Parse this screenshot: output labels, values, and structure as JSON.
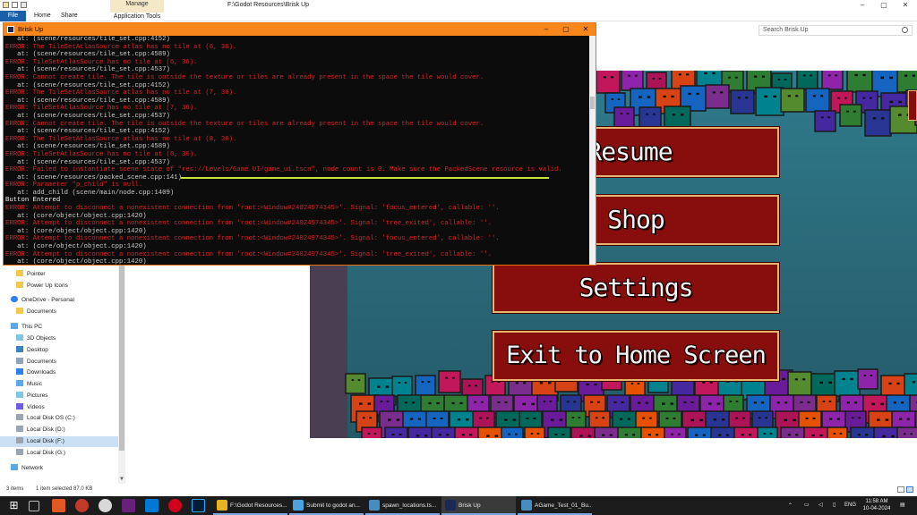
{
  "explorer": {
    "title_path": "F:\\Godot Resources\\Brisk Up",
    "tabs": {
      "file": "File",
      "home": "Home",
      "share": "Share",
      "manage_context": "Manage",
      "application_tools": "Application Tools"
    },
    "search_placeholder": "Search Brisk Up",
    "nav_items": [
      {
        "label": "Pointer",
        "icon": "folder-icon"
      },
      {
        "label": "Power Up Icons",
        "icon": "folder-icon"
      },
      {
        "label": "OneDrive - Personal",
        "icon": "onedrive-icon"
      },
      {
        "label": "Documents",
        "icon": "folder-icon"
      },
      {
        "label": "This PC",
        "icon": "pc-icon"
      },
      {
        "label": "3D Objects",
        "icon": "folder-icon"
      },
      {
        "label": "Desktop",
        "icon": "folder-icon"
      },
      {
        "label": "Documents",
        "icon": "folder-icon"
      },
      {
        "label": "Downloads",
        "icon": "download-icon"
      },
      {
        "label": "Music",
        "icon": "music-icon"
      },
      {
        "label": "Pictures",
        "icon": "pictures-icon"
      },
      {
        "label": "Videos",
        "icon": "videos-icon"
      },
      {
        "label": "Local Disk OS (C:)",
        "icon": "drive-icon"
      },
      {
        "label": "Local Disk (D:)",
        "icon": "drive-icon"
      },
      {
        "label": "Local Disk (F:)",
        "icon": "drive-icon",
        "selected": true
      },
      {
        "label": "Local Disk (G:)",
        "icon": "drive-icon"
      },
      {
        "label": "Network",
        "icon": "network-icon"
      }
    ],
    "status": {
      "items": "3 items",
      "selected": "1 item selected  87.0 KB"
    }
  },
  "console": {
    "title": "Brisk Up",
    "lines": [
      {
        "t": "at",
        "text": "   at: (scene/resources/tile_set.cpp:4152)"
      },
      {
        "t": "error",
        "text": "ERROR: The TileSetAtlasSource atlas has no tile at (6, 36)."
      },
      {
        "t": "at",
        "text": "   at: (scene/resources/tile_set.cpp:4589)"
      },
      {
        "t": "error",
        "text": "ERROR: TileSetAtlasSource has no tile at (6, 36)."
      },
      {
        "t": "at",
        "text": "   at: (scene/resources/tile_set.cpp:4537)"
      },
      {
        "t": "error",
        "text": "ERROR: Cannot create tile. The tile is outside the texture or tiles are already present in the space the tile would cover."
      },
      {
        "t": "at",
        "text": "   at: (scene/resources/tile_set.cpp:4152)"
      },
      {
        "t": "error",
        "text": "ERROR: The TileSetAtlasSource atlas has no tile at (7, 36)."
      },
      {
        "t": "at",
        "text": "   at: (scene/resources/tile_set.cpp:4589)"
      },
      {
        "t": "error",
        "text": "ERROR: TileSetAtlasSource has no tile at (7, 36)."
      },
      {
        "t": "at",
        "text": "   at: (scene/resources/tile_set.cpp:4537)"
      },
      {
        "t": "error",
        "text": "ERROR: Cannot create tile. The tile is outside the texture or tiles are already present in the space the tile would cover."
      },
      {
        "t": "at",
        "text": "   at: (scene/resources/tile_set.cpp:4152)"
      },
      {
        "t": "error",
        "text": "ERROR: The TileSetAtlasSource atlas has no tile at (8, 36)."
      },
      {
        "t": "at",
        "text": "   at: (scene/resources/tile_set.cpp:4589)"
      },
      {
        "t": "error",
        "text": "ERROR: TileSetAtlasSource has no tile at (8, 36)."
      },
      {
        "t": "at",
        "text": "   at: (scene/resources/tile_set.cpp:4537)"
      },
      {
        "t": "error",
        "text": "ERROR: Failed to instantiate scene state of \"res://Levels/Game UI/game_ui.tscn\", node count is 0. Make sure the PackedScene resource is valid."
      },
      {
        "t": "at",
        "text": "   at: (scene/resources/packed_scene.cpp:141)"
      },
      {
        "t": "error",
        "text": "ERROR: Parameter \"p_child\" is null."
      },
      {
        "t": "at",
        "text": "   at: add_child (scene/main/node.cpp:1409)"
      },
      {
        "t": "info",
        "text": "Button Entered"
      },
      {
        "t": "error",
        "text": "ERROR: Attempt to disconnect a nonexistent connection from 'root:<Window#24024974345>'. Signal: 'focus_entered', callable: ''."
      },
      {
        "t": "at",
        "text": "   at: (core/object/object.cpp:1420)"
      },
      {
        "t": "error",
        "text": "ERROR: Attempt to disconnect a nonexistent connection from 'root:<Window#24024974345>'. Signal: 'tree_exited', callable: ''."
      },
      {
        "t": "at",
        "text": "   at: (core/object/object.cpp:1420)"
      },
      {
        "t": "error",
        "text": "ERROR: Attempt to disconnect a nonexistent connection from 'root:<Window#24024974345>'. Signal: 'focus_entered', callable: ''."
      },
      {
        "t": "at",
        "text": "   at: (core/object/object.cpp:1420)"
      },
      {
        "t": "error",
        "text": "ERROR: Attempt to disconnect a nonexistent connection from 'root:<Window#24024974345>'. Signal: 'tree_exited', callable: ''."
      },
      {
        "t": "at",
        "text": "   at: (core/object/object.cpp:1420)"
      }
    ]
  },
  "game_menu": {
    "resume": "Resume",
    "shop": "Shop",
    "settings": "Settings",
    "exit": "Exit to Home Screen"
  },
  "taskbar": {
    "tasks": [
      {
        "label": "F:\\Godot Resources...",
        "icon_color": "#e6b422"
      },
      {
        "label": "Submit to godot an...",
        "icon_color": "#4aa3df"
      },
      {
        "label": "spawn_locations.ts...",
        "icon_color": "#478cbf"
      },
      {
        "label": "Brisk Up",
        "icon_color": "#1b2a55",
        "active": true
      },
      {
        "label": "AGame_Test_01_Bu...",
        "icon_color": "#478cbf"
      }
    ],
    "language": "ENG",
    "time": "11:58 AM",
    "date": "10-04-2024"
  },
  "colors": {
    "error": "#d62424",
    "console_title": "#f7861c",
    "button_red": "#880e0e",
    "button_border": "#e8b36b",
    "highlight_mark": "#c8e33a"
  }
}
